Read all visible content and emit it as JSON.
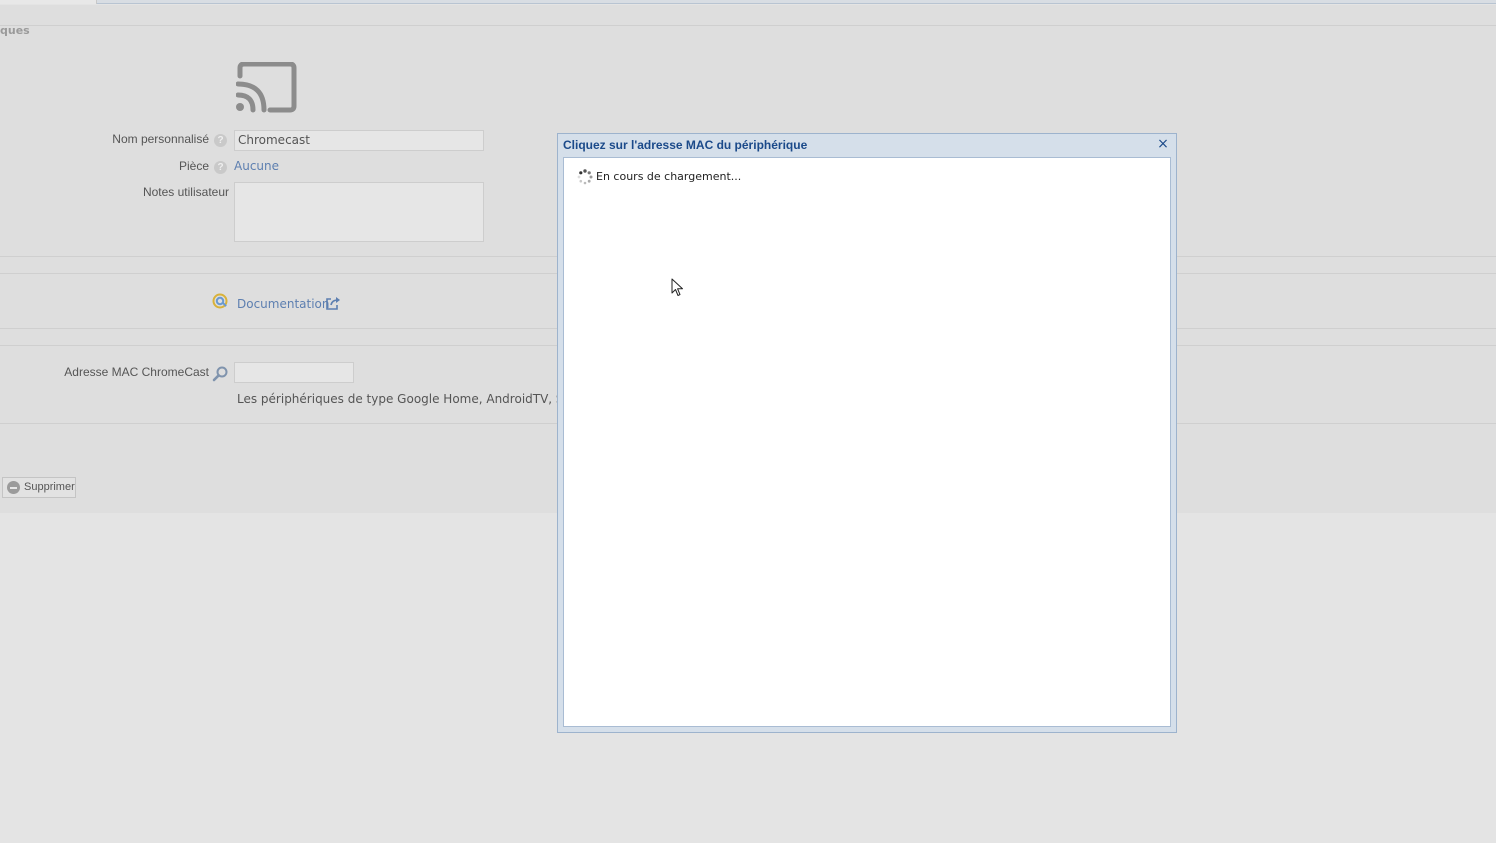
{
  "section": {
    "title": "ques"
  },
  "form": {
    "custom_name": {
      "label": "Nom personnalisé",
      "value": "Chromecast",
      "help": "?"
    },
    "room": {
      "label": "Pièce",
      "value": "Aucune",
      "help": "?"
    },
    "notes": {
      "label": "Notes utilisateur",
      "value": ""
    },
    "documentation": {
      "label": "Documentation"
    },
    "mac": {
      "label": "Adresse MAC ChromeCast",
      "value": "",
      "help_text": "Les périphériques de type Google Home, AndroidTV, Stick"
    }
  },
  "actions": {
    "delete_label": "Supprimer"
  },
  "dialog": {
    "title": "Cliquez sur l'adresse MAC du périphérique",
    "close_glyph": "×",
    "loading_text": "En cours de chargement..."
  },
  "icons": {
    "cast": "cast-icon",
    "help": "help-icon",
    "documentation": "documentation-icon",
    "external_link": "external-link-icon",
    "search": "search-icon",
    "delete": "minus-circle-icon",
    "spinner": "spinner-icon",
    "close": "close-icon",
    "cursor": "mouse-cursor-icon"
  },
  "colors": {
    "link": "#5d7fb0",
    "dialog_title": "#1b4a8a",
    "dialog_frame": "#d5dfea"
  }
}
